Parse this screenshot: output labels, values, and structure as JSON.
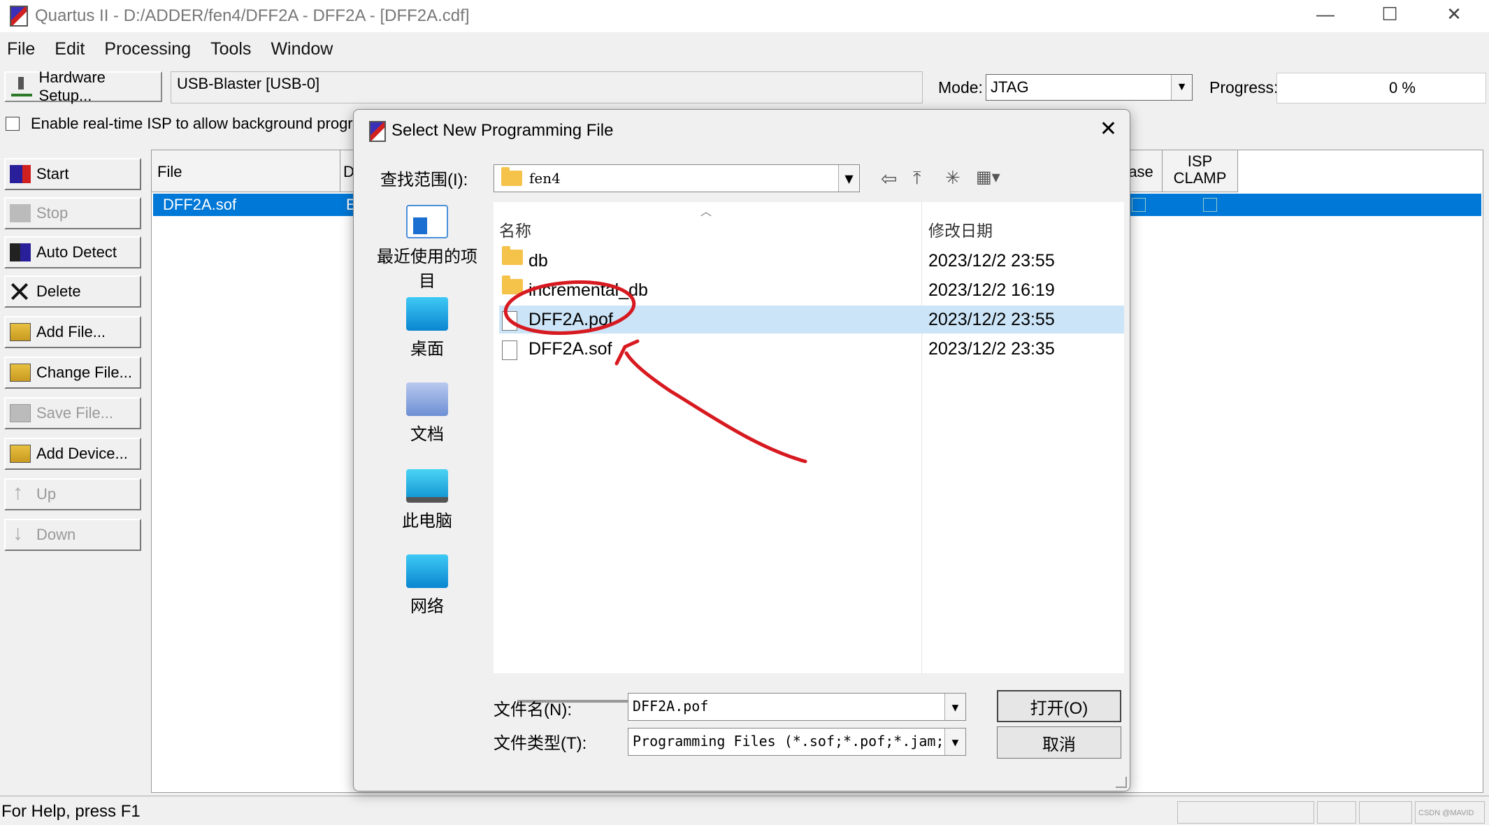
{
  "window": {
    "title": "Quartus II - D:/ADDER/fen4/DFF2A - DFF2A - [DFF2A.cdf]",
    "controls": {
      "minimize": "—",
      "maximize": "☐",
      "close": "✕"
    }
  },
  "menu": [
    "File",
    "Edit",
    "Processing",
    "Tools",
    "Window"
  ],
  "toolbar": {
    "hardware_setup": "Hardware Setup...",
    "hardware_value": "USB-Blaster [USB-0]",
    "mode_label": "Mode:",
    "mode_value": "JTAG",
    "progress_label": "Progress:",
    "progress_value": "0 %",
    "isp_label": "Enable real-time ISP to allow background prograr"
  },
  "side_buttons": [
    {
      "label": "Start",
      "icon": "start-icon",
      "enabled": true
    },
    {
      "label": "Stop",
      "icon": "stop-icon",
      "enabled": false
    },
    {
      "label": "Auto Detect",
      "icon": "auto-detect-icon",
      "enabled": true
    },
    {
      "label": "Delete",
      "icon": "delete-icon",
      "enabled": true
    },
    {
      "label": "Add File...",
      "icon": "add-file-icon",
      "enabled": true
    },
    {
      "label": "Change File...",
      "icon": "change-file-icon",
      "enabled": true
    },
    {
      "label": "Save File...",
      "icon": "save-file-icon",
      "enabled": false
    },
    {
      "label": "Add Device...",
      "icon": "add-device-icon",
      "enabled": true
    },
    {
      "label": "Up",
      "icon": "up-arrow-icon",
      "enabled": false
    },
    {
      "label": "Down",
      "icon": "down-arrow-icon",
      "enabled": false
    }
  ],
  "table": {
    "col_file": "File",
    "col_device_partial": "D",
    "col_erase_partial": "rase",
    "col_isp_clamp": "ISP\nCLAMP",
    "selected_file": "DFF2A.sof",
    "selected_device_partial": "E"
  },
  "status": {
    "help_text": "For Help, press F1",
    "watermark": "CSDN @MAVID"
  },
  "dialog": {
    "title": "Select New Programming File",
    "close": "✕",
    "look_in_label": "查找范围(I):",
    "look_in_value": "fen4",
    "places": [
      "最近使用的项目",
      "桌面",
      "文档",
      "此电脑",
      "网络"
    ],
    "columns": {
      "name": "名称",
      "date": "修改日期"
    },
    "files": [
      {
        "name": "db",
        "type": "folder",
        "date": "2023/12/2 23:55"
      },
      {
        "name": "incremental_db",
        "type": "folder",
        "date": "2023/12/2 16:19"
      },
      {
        "name": "DFF2A.pof",
        "type": "file",
        "date": "2023/12/2 23:55",
        "selected": true
      },
      {
        "name": "DFF2A.sof",
        "type": "file",
        "date": "2023/12/2 23:35"
      }
    ],
    "filename_label": "文件名(N):",
    "filename_value": "DFF2A.pof",
    "filetype_label": "文件类型(T):",
    "filetype_value": "Programming Files (*.sof;*.pof;*.jam;",
    "open_button": "打开(O)",
    "cancel_button": "取消"
  },
  "colors": {
    "selection": "#0078d7",
    "list_selection": "#cce4f7",
    "annotation": "#d71920"
  }
}
